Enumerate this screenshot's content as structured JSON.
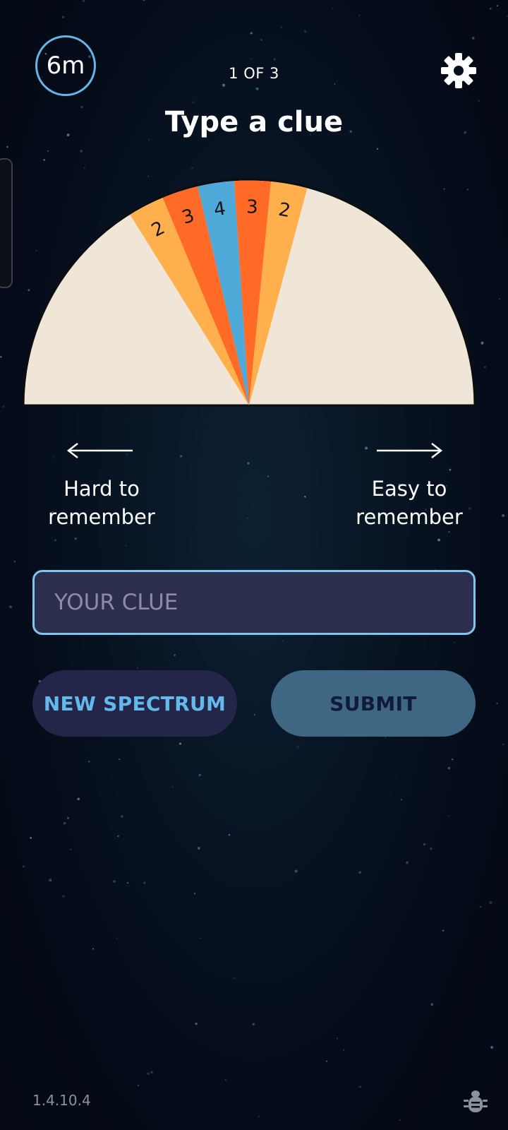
{
  "header": {
    "timer": "6m",
    "progress": "1 OF 3",
    "title": "Type a clue",
    "settings_icon": "gear-icon"
  },
  "dial": {
    "scores": [
      "2",
      "3",
      "4",
      "3",
      "2"
    ],
    "colors": {
      "face": "#efe6d7",
      "outer": "#ffb04c",
      "middle": "#ff6a26",
      "center": "#4fa9d9",
      "rim": "#0c0d10"
    }
  },
  "spectrum": {
    "left": "Hard to remember",
    "right": "Easy to remember",
    "left_icon": "arrow-left-icon",
    "right_icon": "arrow-right-icon"
  },
  "clue_input": {
    "value": "",
    "placeholder": "YOUR CLUE"
  },
  "buttons": {
    "new_spectrum": "NEW SPECTRUM",
    "submit": "SUBMIT"
  },
  "footer": {
    "version": "1.4.10.4",
    "bug_icon": "bug-icon"
  },
  "theme": {
    "accent": "#63b6e6",
    "background": "#050b18"
  }
}
